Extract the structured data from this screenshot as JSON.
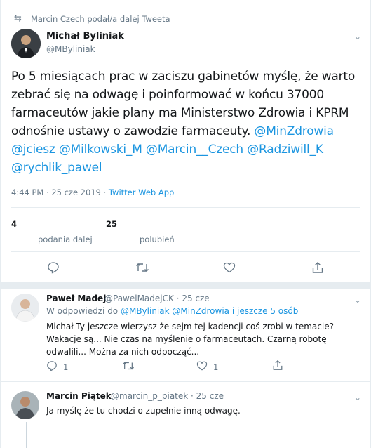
{
  "retweet_context": {
    "text": "Marcin Czech podał/a dalej Tweeta"
  },
  "tweet": {
    "author_name": "Michał Byliniak",
    "author_handle": "@MByliniak",
    "text": "Po 5 miesiącach prac w zaciszu gabinetów myślę, że warto zebrać się na odwagę i poinformować w końcu 37000 farmaceutów jakie plany ma Ministerstwo Zdrowia i KPRM odnośnie ustawy o zawodzie farmaceuty.",
    "mentions": "@MinZdrowia @jciesz @Milkowski_M @Marcin__Czech @Radziwill_K @rychlik_pawel",
    "time": "4:44 PM · 25 cze 2019 · ",
    "source": "Twitter Web App",
    "retweets_count": "4",
    "retweets_label": "podania dalej",
    "likes_count": "25",
    "likes_label": "polubień"
  },
  "replies": [
    {
      "name": "Paweł Madej",
      "handle": "@PawelMadejCK · 25 cze",
      "reply_to_prefix": "W odpowiedzi do ",
      "reply_to_users": "@MByliniak @MinZdrowia i jeszcze 5 osób",
      "text": "Michał Ty jeszcze wierzysz że sejm tej kadencji coś zrobi w temacie? Wakacje są... Nie czas na myślenie o farmaceutach. Czarną robotę odwalili... Można za nich odpocząć...",
      "reply_count": "1",
      "retweet_count": "",
      "like_count": "1"
    },
    {
      "name": "Marcin Piątek",
      "handle": "@marcin_p_piatek · 25 cze",
      "text": "Ja myślę że tu chodzi o zupełnie inną odwagę."
    }
  ],
  "icons": {
    "retweet": "retweet-icon",
    "reply": "reply-icon",
    "like": "heart-icon",
    "share": "share-icon",
    "menu": "chevron-down-icon"
  },
  "colors": {
    "link": "#1b95e0",
    "secondary": "#657786",
    "border": "#e6ecf0"
  }
}
